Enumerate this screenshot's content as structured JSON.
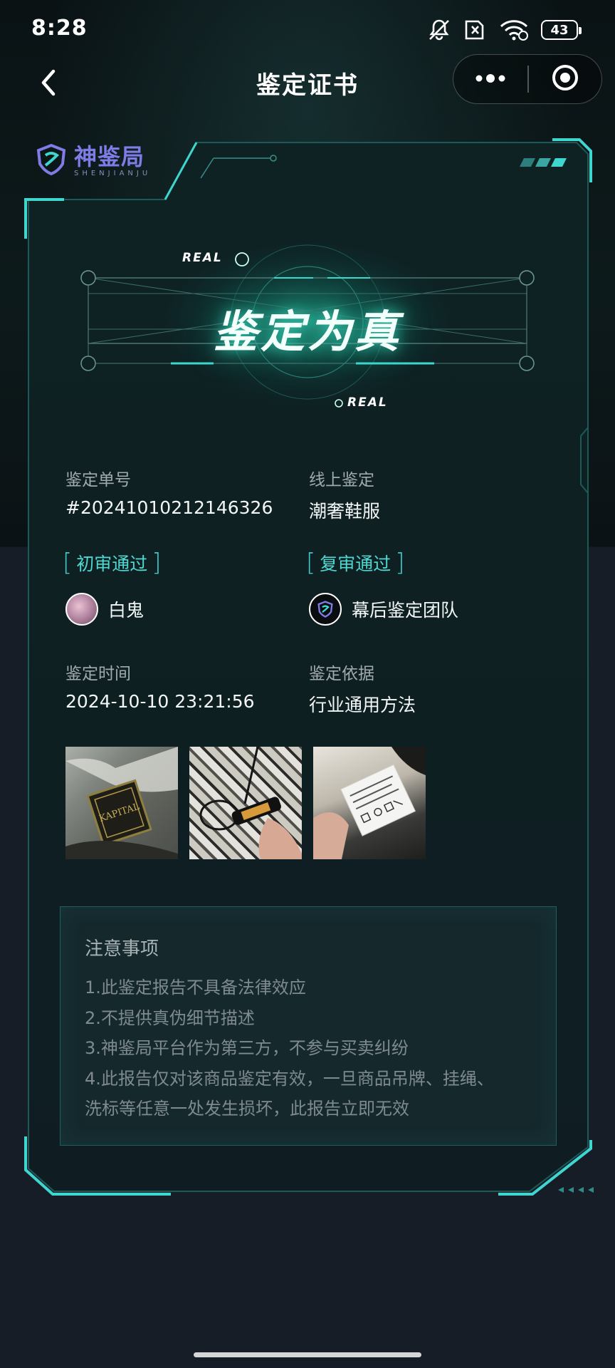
{
  "status_bar": {
    "time": "8:28",
    "battery": "43",
    "icons": [
      "mute-icon",
      "sim-off-icon",
      "wifi-icon",
      "battery-icon"
    ]
  },
  "nav": {
    "title": "鉴定证书",
    "back_icon": "chevron-left-icon",
    "more_icon": "more-dots-icon",
    "close_icon": "target-close-icon"
  },
  "brand": {
    "name": "神鉴局",
    "sub": "SHENJIANJU"
  },
  "result": {
    "title": "鉴定为真",
    "tag_top": "REAL",
    "tag_bottom": "REAL"
  },
  "info": {
    "order_label": "鉴定单号",
    "order_value": "#20241010212146326",
    "type_label": "线上鉴定",
    "type_value": "潮奢鞋服",
    "first_review": "初审通过",
    "first_reviewer": "白鬼",
    "second_review": "复审通过",
    "second_reviewer": "幕后鉴定团队",
    "time_label": "鉴定时间",
    "time_value": "2024-10-10 23:21:56",
    "basis_label": "鉴定依据",
    "basis_value": "行业通用方法"
  },
  "photos": [
    {
      "label": "KAPITAL"
    },
    {
      "label": "zipper-pull"
    },
    {
      "label": "care-label"
    }
  ],
  "notice": {
    "title": "注意事项",
    "lines": [
      "1.此鉴定报告不具备法律效应",
      "2.不提供真伪细节描述",
      "3.神鉴局平台作为第三方，不参与买卖纠纷",
      "4.此报告仅对该商品鉴定有效，一旦商品吊牌、挂绳、",
      "洗标等任意一处发生损坏，此报告立即无效"
    ]
  },
  "colors": {
    "accent": "#3fd6cf",
    "glow": "#22c9a8",
    "brand": "#7f7ce6",
    "bg_top": "#0d1a1b",
    "bg_bottom": "#161d27"
  }
}
